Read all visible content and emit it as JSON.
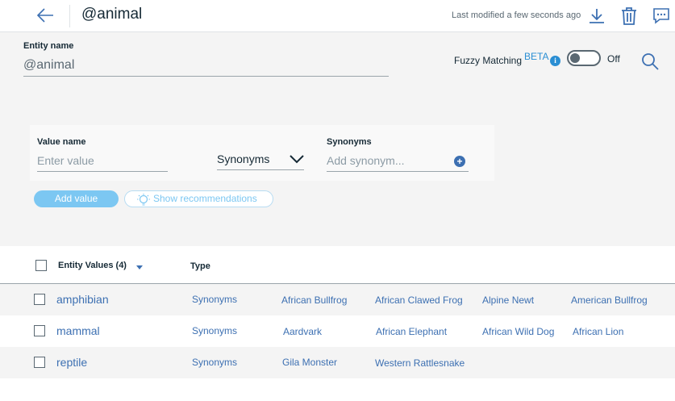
{
  "header": {
    "title": "@animal",
    "last_modified": "Last modified a few seconds ago",
    "icons": [
      "back-arrow-icon",
      "download-icon",
      "trash-icon",
      "chat-icon"
    ]
  },
  "entity": {
    "name_label": "Entity name",
    "name_value": "@animal",
    "fuzzy_label": "Fuzzy Matching",
    "beta_label": "BETA",
    "info_glyph": "i",
    "toggle_state": "Off"
  },
  "value_form": {
    "value_label": "Value name",
    "value_placeholder": "Enter value",
    "type_selected": "Synonyms",
    "synonyms_label": "Synonyms",
    "synonyms_placeholder": "Add synonym...",
    "add_button": "Add value",
    "recommend_button": "Show recommendations"
  },
  "table": {
    "col_values": "Entity Values (4)",
    "col_type": "Type",
    "rows": [
      {
        "value": "amphibian",
        "type": "Synonyms",
        "synonyms": [
          "African Bullfrog",
          "African Clawed Frog",
          "Alpine Newt",
          "American Bullfrog"
        ]
      },
      {
        "value": "mammal",
        "type": "Synonyms",
        "synonyms": [
          "Aardvark",
          "African Elephant",
          "African Wild Dog",
          "African Lion"
        ]
      },
      {
        "value": "reptile",
        "type": "Synonyms",
        "synonyms": [
          "Gila Monster",
          "Western Rattlesnake"
        ]
      }
    ]
  },
  "colors": {
    "accent": "#3d70b2",
    "link": "#2a8ed3",
    "add_button_bg": "#7cc7f2",
    "panel_bg": "#f4f4f4"
  }
}
